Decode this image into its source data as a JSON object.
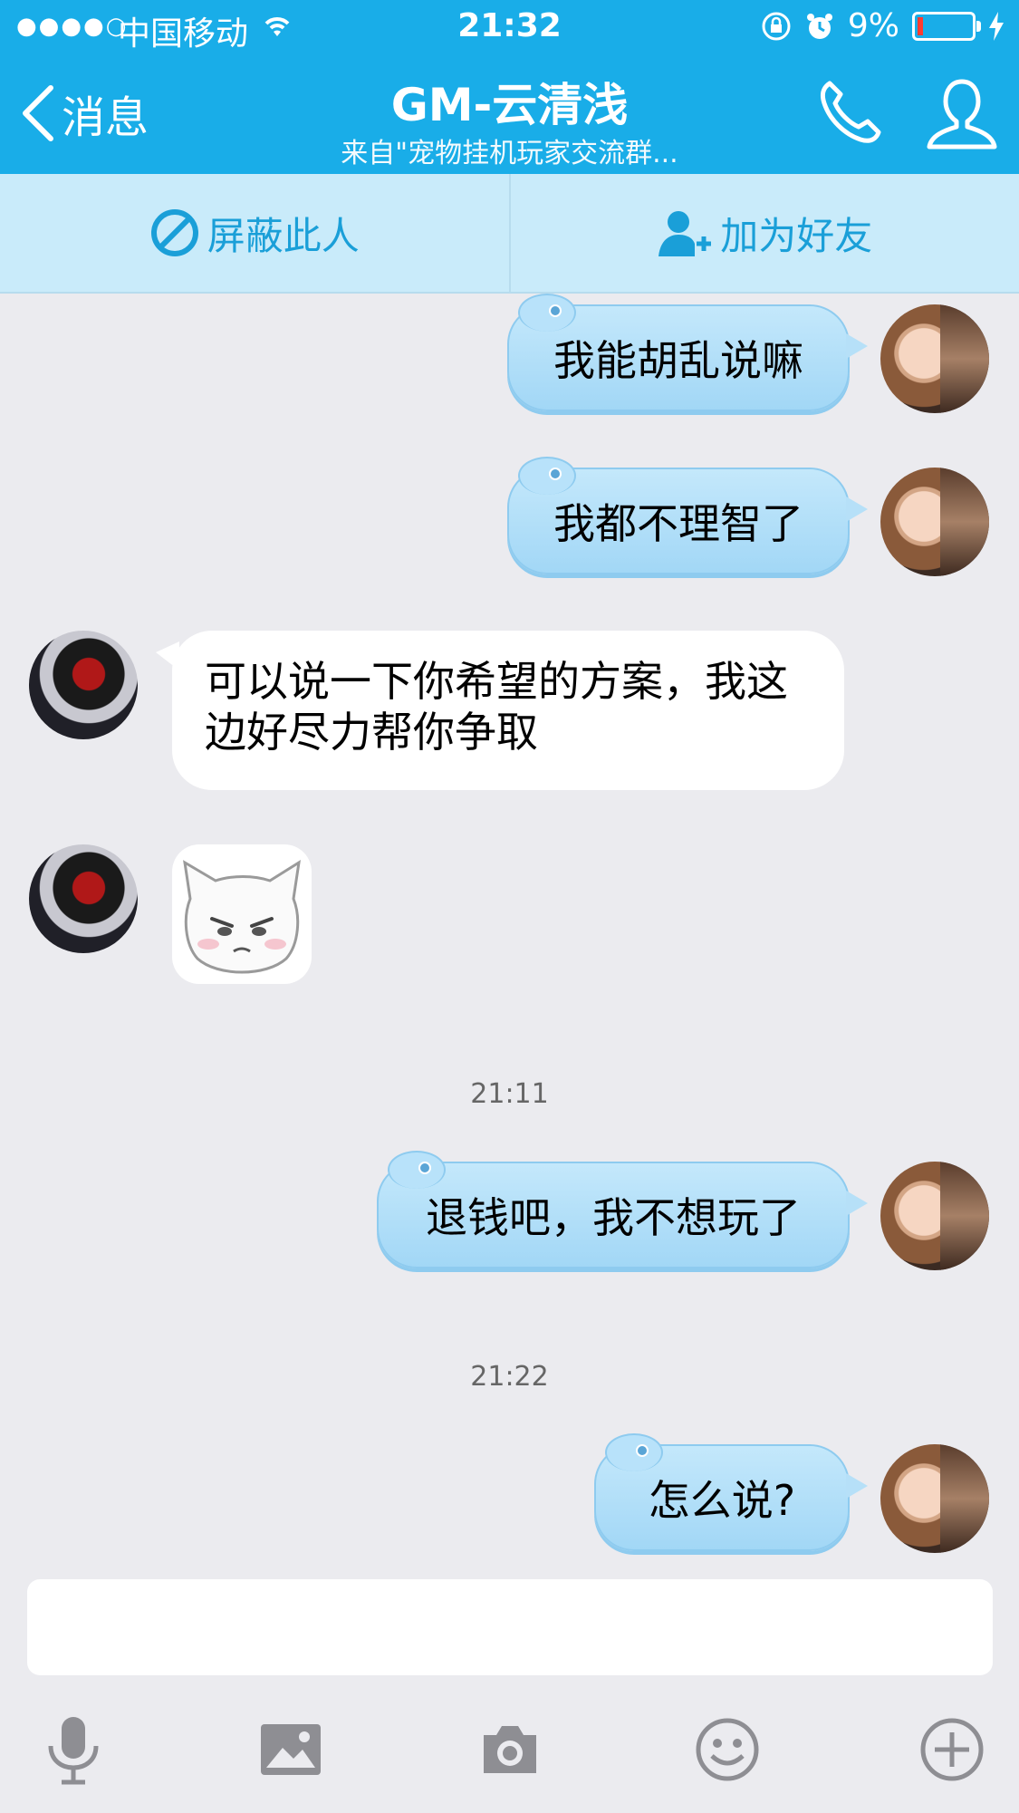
{
  "status_bar": {
    "signal": "●●●●○",
    "carrier": "中国移动",
    "time": "21:32",
    "battery": "9%"
  },
  "header": {
    "back_label": "消息",
    "title": "GM-云清浅",
    "subtitle": "来自\"宠物挂机玩家交流群..."
  },
  "actions": {
    "block_label": "屏蔽此人",
    "add_friend_label": "加为好友"
  },
  "messages": [
    {
      "side": "out",
      "text": "我能胡乱说嘛"
    },
    {
      "side": "out",
      "text": "我都不理智了"
    },
    {
      "side": "in",
      "text": "可以说一下你希望的方案，我这边好尽力帮你争取"
    },
    {
      "side": "in",
      "type": "sticker"
    },
    {
      "type": "time",
      "text": "21:11"
    },
    {
      "side": "out",
      "text": "退钱吧，我不想玩了"
    },
    {
      "type": "time",
      "text": "21:22"
    },
    {
      "side": "out",
      "text": "怎么说?"
    }
  ],
  "input": {
    "placeholder": ""
  },
  "toolbar": {
    "icons": [
      "microphone-icon",
      "image-icon",
      "camera-icon",
      "emoji-icon",
      "plus-icon"
    ]
  },
  "colors": {
    "accent": "#19ade8",
    "action_bar": "#c9ebfa",
    "out_bubble": "#a8dbf7",
    "background": "#ebebef"
  }
}
